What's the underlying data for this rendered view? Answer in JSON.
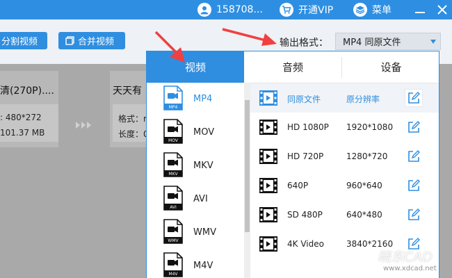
{
  "titlebar": {
    "account": "158708...",
    "vip": "开通VIP",
    "menu": "菜单"
  },
  "toolbar": {
    "split_label": "分割视频",
    "merge_label": "合并视频",
    "output_format_label": "输出格式：",
    "output_format_value": "MP4  同原文件"
  },
  "files": [
    {
      "name": "清(270P)....",
      "resolution": "480*272",
      "size": "101.37 MB"
    },
    {
      "name": "天天有",
      "format_label": "格式：r",
      "duration_label": "长度：0"
    }
  ],
  "popup": {
    "tabs": [
      {
        "label": "视频",
        "active": true
      },
      {
        "label": "音频",
        "active": false
      },
      {
        "label": "设备",
        "active": false
      }
    ],
    "formats": [
      {
        "name": "MP4",
        "icon_label": "MP4",
        "selected": true
      },
      {
        "name": "MOV",
        "icon_label": "MOV",
        "selected": false
      },
      {
        "name": "MKV",
        "icon_label": "MKV",
        "selected": false
      },
      {
        "name": "AVI",
        "icon_label": "AVI",
        "selected": false
      },
      {
        "name": "WMV",
        "icon_label": "WMV",
        "selected": false
      },
      {
        "name": "M4V",
        "icon_label": "M4V",
        "selected": false
      }
    ],
    "resolutions": [
      {
        "name": "同原文件",
        "value": "原分辨率"
      },
      {
        "name": "HD 1080P",
        "value": "1920*1080"
      },
      {
        "name": "HD 720P",
        "value": "1280*720"
      },
      {
        "name": "640P",
        "value": "960*640"
      },
      {
        "name": "SD 480P",
        "value": "640*480"
      },
      {
        "name": "4K Video",
        "value": "3840*2160"
      }
    ]
  },
  "watermark": {
    "brand": "晓东CAD",
    "url": "www.xdcad.net"
  },
  "colors": {
    "accent": "#2f8ee0",
    "arrow": "#f04040"
  },
  "icons": {
    "account": "user-icon",
    "vip": "cart-icon",
    "menu": "stack-icon",
    "minimize": "minimize-icon",
    "close": "close-icon",
    "format": "video-file-icon",
    "resolution": "film-icon",
    "edit": "edit-icon",
    "convert": "forward-arrows-icon"
  }
}
